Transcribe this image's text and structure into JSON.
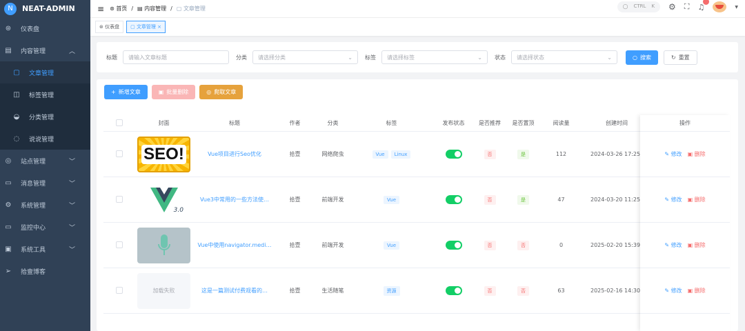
{
  "app": {
    "name": "NEAT-ADMIN",
    "logo_letter": "N"
  },
  "sidebar": {
    "items": [
      {
        "label": "仪表盘",
        "icon": "dashboard-icon"
      },
      {
        "label": "内容管理",
        "icon": "document-icon",
        "expanded": true,
        "children": [
          {
            "label": "文章管理",
            "active": true
          },
          {
            "label": "标签管理"
          },
          {
            "label": "分类管理"
          },
          {
            "label": "说说管理"
          }
        ]
      },
      {
        "label": "站点管理"
      },
      {
        "label": "消息管理"
      },
      {
        "label": "系统管理"
      },
      {
        "label": "监控中心"
      },
      {
        "label": "系统工具"
      },
      {
        "label": "拾壹博客"
      }
    ]
  },
  "header": {
    "breadcrumb": [
      "首页",
      "内容管理",
      "文章管理"
    ],
    "search_hint": "CTRL",
    "search_key": "K"
  },
  "tabs": [
    {
      "label": "仪表盘"
    },
    {
      "label": "文章管理",
      "active": true
    }
  ],
  "search": {
    "title_label": "标题",
    "title_placeholder": "请输入文章标题",
    "category_label": "分类",
    "category_placeholder": "请选择分类",
    "tag_label": "标签",
    "tag_placeholder": "请选择标签",
    "status_label": "状态",
    "status_placeholder": "请选择状态",
    "search_btn": "搜索",
    "reset_btn": "重置"
  },
  "toolbar": {
    "add": "新增文章",
    "batch_delete": "批量删除",
    "crawl": "爬取文章"
  },
  "table": {
    "headers": [
      "封面",
      "标题",
      "作者",
      "分类",
      "标签",
      "发布状态",
      "是否推荐",
      "是否置顶",
      "阅读量",
      "创建时间",
      "操作"
    ],
    "rows": [
      {
        "cover": "SEO!",
        "title": "Vue项目进行Seo优化",
        "author": "拾壹",
        "category": "网络爬虫",
        "tags": [
          "Vue",
          "Linux"
        ],
        "published": true,
        "recommend": "否",
        "top": "是",
        "reads": "112",
        "created": "2024-03-26 17:25:"
      },
      {
        "cover": "3.0",
        "title": "Vue3中常用的一些方法使…",
        "author": "拾壹",
        "category": "前端开发",
        "tags": [
          "Vue"
        ],
        "published": true,
        "recommend": "否",
        "top": "是",
        "reads": "47",
        "created": "2024-03-20 11:25:"
      },
      {
        "cover": "",
        "title": "Vue中使用navigator.medi…",
        "author": "拾壹",
        "category": "前端开发",
        "tags": [
          "Vue"
        ],
        "published": true,
        "recommend": "否",
        "top": "否",
        "reads": "0",
        "created": "2025-02-20 15:39:"
      },
      {
        "cover": "加载失败",
        "title": "这是一篇测试付费观看的…",
        "author": "拾壹",
        "category": "生活随笔",
        "tags": [
          "资源"
        ],
        "published": true,
        "recommend": "否",
        "top": "否",
        "reads": "63",
        "created": "2025-02-16 14:30:"
      }
    ],
    "edit": "修改",
    "delete": "删除"
  }
}
